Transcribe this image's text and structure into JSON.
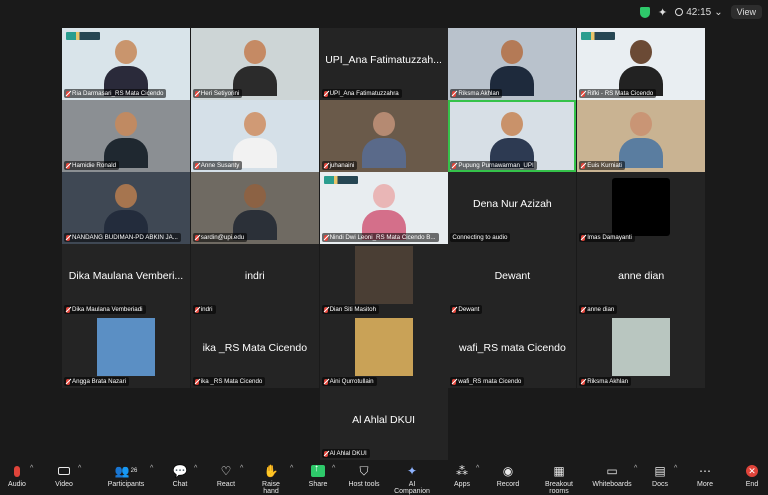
{
  "status": {
    "timer": "42:15",
    "view_label": "View"
  },
  "participants": [
    {
      "name": "Ria Darmasari_RS Mata Cicendo",
      "bg": "#d9e4ea",
      "kind": "video",
      "skin": "#c9956d",
      "cloth": "#2a2a3a"
    },
    {
      "name": "Heri Setiyorini",
      "bg": "#cdd5d6",
      "kind": "video",
      "skin": "#c58a64",
      "cloth": "#2b2b2b"
    },
    {
      "name": "UPI_Ana Fatimatuzzahra",
      "display": "UPI_Ana Fatimatuzzah...",
      "kind": "text"
    },
    {
      "name": "Riksma Akhlan",
      "bg": "#b9c2cc",
      "kind": "video",
      "skin": "#b47a56",
      "cloth": "#1e2a3c"
    },
    {
      "name": "Rifki - RS Mata Cicendo",
      "bg": "#e9eef2",
      "kind": "video",
      "skin": "#6b4a35",
      "cloth": "#222"
    },
    {
      "name": "Hamidie Ronald",
      "bg": "#8b8f93",
      "kind": "video",
      "skin": "#c08a62",
      "cloth": "#1f2830"
    },
    {
      "name": "Anne Susanty",
      "bg": "#d5e0e8",
      "kind": "video",
      "skin": "#d09a75",
      "cloth": "#f2f2f2"
    },
    {
      "name": "juhanaini",
      "bg": "#6a5a4a",
      "kind": "video",
      "skin": "#b58a72",
      "cloth": "#5a6a8a"
    },
    {
      "name": "Pupung Purnawarman_UPI",
      "bg": "#d7dfe6",
      "kind": "video",
      "skin": "#c9926a",
      "cloth": "#2d3a52",
      "active": true
    },
    {
      "name": "Euis Kurniati",
      "bg": "#c9b392",
      "kind": "video",
      "skin": "#c99575",
      "cloth": "#5a7da0"
    },
    {
      "name": "NANDANG BUDIMAN-PD ABKIN JA...",
      "bg": "#3f4854",
      "kind": "video",
      "skin": "#a6754f",
      "cloth": "#232c3c"
    },
    {
      "name": "sardin@upi.edu",
      "bg": "#6f6a62",
      "kind": "video",
      "skin": "#8c6244",
      "cloth": "#2b3038"
    },
    {
      "name": "Nindi Dwi Leoni_RS Mata Cicendo B...",
      "bg": "#e8edf0",
      "kind": "video",
      "skin": "#e9b6b6",
      "cloth": "#d46f8a"
    },
    {
      "name": "Connecting to audio",
      "display": "Dena Nur Azizah",
      "kind": "text"
    },
    {
      "name": "Imas Damayanti",
      "kind": "black"
    },
    {
      "name": "Dika Maulana Vemberiadi",
      "display": "Dika Maulana Vemberi...",
      "kind": "text"
    },
    {
      "name": "indri",
      "display": "indri",
      "kind": "text"
    },
    {
      "name": "Dian Siti Masitoh",
      "kind": "thumb",
      "bg": "#4a3e34"
    },
    {
      "name": "Dewant",
      "display": "Dewant",
      "kind": "text"
    },
    {
      "name": "anne dian",
      "display": "anne dian",
      "kind": "text"
    },
    {
      "name": "Angga Brata Nazari",
      "kind": "thumb",
      "bg": "#5b8fc4"
    },
    {
      "name": "ika _RS Mata Cicendo",
      "display": "ika _RS Mata Cicendo",
      "kind": "text"
    },
    {
      "name": "Aini Qurrotullain",
      "kind": "thumb",
      "bg": "#c9a257"
    },
    {
      "name": "wafi_RS mata Cicendo",
      "display": "wafi_RS mata Cicendo",
      "kind": "text"
    },
    {
      "name": "Riksma Akhlan",
      "kind": "thumb",
      "bg": "#b9c6c0"
    },
    {
      "name": "Al Ahlal DKUI",
      "display": "Al Ahlal DKUI",
      "kind": "text"
    }
  ],
  "toolbar": {
    "audio": "Audio",
    "video": "Video",
    "participants": "Participants",
    "participants_count": "26",
    "chat": "Chat",
    "react": "React",
    "raise_hand": "Raise hand",
    "share": "Share",
    "host_tools": "Host tools",
    "ai_companion": "AI Companion",
    "apps": "Apps",
    "record": "Record",
    "breakout_rooms": "Breakout rooms",
    "whiteboards": "Whiteboards",
    "docs": "Docs",
    "more": "More",
    "end": "End"
  }
}
